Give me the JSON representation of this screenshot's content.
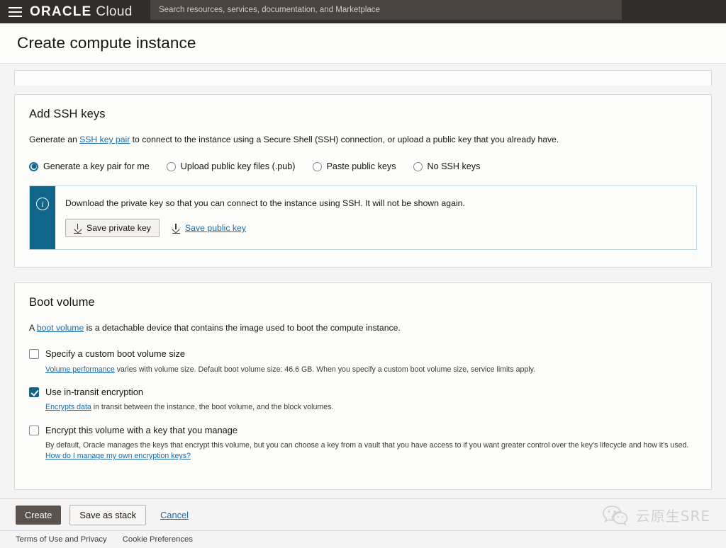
{
  "topbar": {
    "menu_icon": "hamburger-menu-icon",
    "logo_oracle": "ORACLE",
    "logo_cloud": "Cloud",
    "search_placeholder": "Search resources, services, documentation, and Marketplace",
    "search_value": ""
  },
  "header": {
    "title": "Create compute instance"
  },
  "ssh_section": {
    "title": "Add SSH keys",
    "description_before": "Generate an ",
    "description_link": "SSH key pair",
    "description_after": " to connect to the instance using a Secure Shell (SSH) connection, or upload a public key that you already have.",
    "options": [
      {
        "label": "Generate a key pair for me",
        "selected": true
      },
      {
        "label": "Upload public key files (.pub)",
        "selected": false
      },
      {
        "label": "Paste public keys",
        "selected": false
      },
      {
        "label": "No SSH keys",
        "selected": false
      }
    ],
    "banner": {
      "icon": "info-icon",
      "text": "Download the private key so that you can connect to the instance using SSH. It will not be shown again.",
      "save_private_label": "Save private key",
      "save_public_label": "Save public key"
    }
  },
  "boot_section": {
    "title": "Boot volume",
    "description_before": "A ",
    "description_link": "boot volume",
    "description_after": " is a detachable device that contains the image used to boot the compute instance.",
    "options": [
      {
        "label": "Specify a custom boot volume size",
        "checked": false,
        "note_link": "Volume performance",
        "note_text": " varies with volume size. Default boot volume size: 46.6 GB. When you specify a custom boot volume size, service limits apply.",
        "note_link2": "",
        "note_text2": ""
      },
      {
        "label": "Use in-transit encryption",
        "checked": true,
        "note_link": "Encrypts data",
        "note_text": " in transit between the instance, the boot volume, and the block volumes.",
        "note_link2": "",
        "note_text2": ""
      },
      {
        "label": "Encrypt this volume with a key that you manage",
        "checked": false,
        "note_link": "",
        "note_text": "By default, Oracle manages the keys that encrypt this volume, but you can choose a key from a vault that you have access to if you want greater control over the key's lifecycle and how it's used. ",
        "note_link2": "How do I manage my own encryption keys?",
        "note_text2": ""
      }
    ]
  },
  "actions": {
    "create_label": "Create",
    "save_stack_label": "Save as stack",
    "cancel_label": "Cancel"
  },
  "watermark": {
    "icon": "wechat-icon",
    "text": "云原生SRE"
  },
  "footer": {
    "terms_label": "Terms of Use and Privacy",
    "cookie_label": "Cookie Preferences"
  },
  "colors": {
    "topbar_bg": "#312d2a",
    "accent_blue": "#10658a",
    "link_blue": "#1c6ca8",
    "primary_button": "#5b524d"
  }
}
